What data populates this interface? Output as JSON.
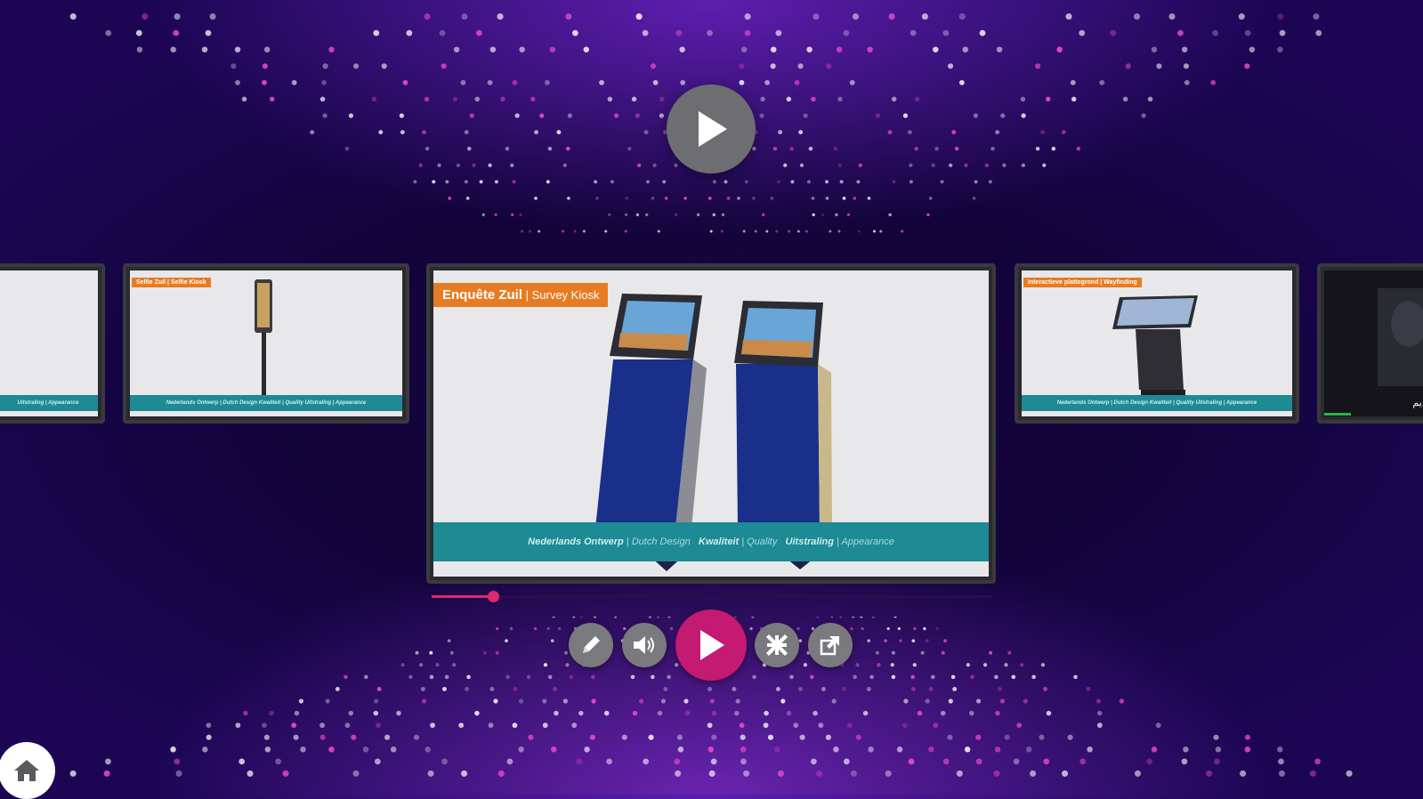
{
  "colors": {
    "accent": "#c41a72",
    "progress": "#e0286a",
    "control_grey": "#7a7a7e",
    "slide_band": "#1d8a94",
    "slide_tag": "#e77b24"
  },
  "player": {
    "progress_fraction": 0.11,
    "big_play_icon": "play-icon"
  },
  "slides": {
    "far_left": {
      "band": "Uitstraling | Appearance"
    },
    "left": {
      "tag": "Selfie Zuil | Selfie Kiosk",
      "band": "Nederlands Ontwerp | Dutch Design  Kwaliteit | Quality  Uitstraling | Appearance"
    },
    "main": {
      "tag_bold": "Enquête Zuil",
      "tag_rest": " | Survey Kiosk",
      "band_parts": [
        {
          "bold": "Nederlands Ontwerp",
          "rest": " | Dutch Design"
        },
        {
          "bold": "Kwaliteit",
          "rest": " | Quality"
        },
        {
          "bold": "Uitstraling",
          "rest": " | Appearance"
        }
      ]
    },
    "right": {
      "tag": "Interactieve plattegrond | Wayfinding",
      "band": "Nederlands Ontwerp | Dutch Design  Kwaliteit | Quality  Uitstraling | Appearance"
    },
    "far_right": {
      "caption": "رديم"
    }
  },
  "controls": {
    "edit_icon": "pencil-icon",
    "volume_icon": "speaker-icon",
    "play_icon": "play-icon",
    "fullscreen_icon": "collapse-icon",
    "share_icon": "external-link-icon",
    "home_icon": "home-icon"
  }
}
